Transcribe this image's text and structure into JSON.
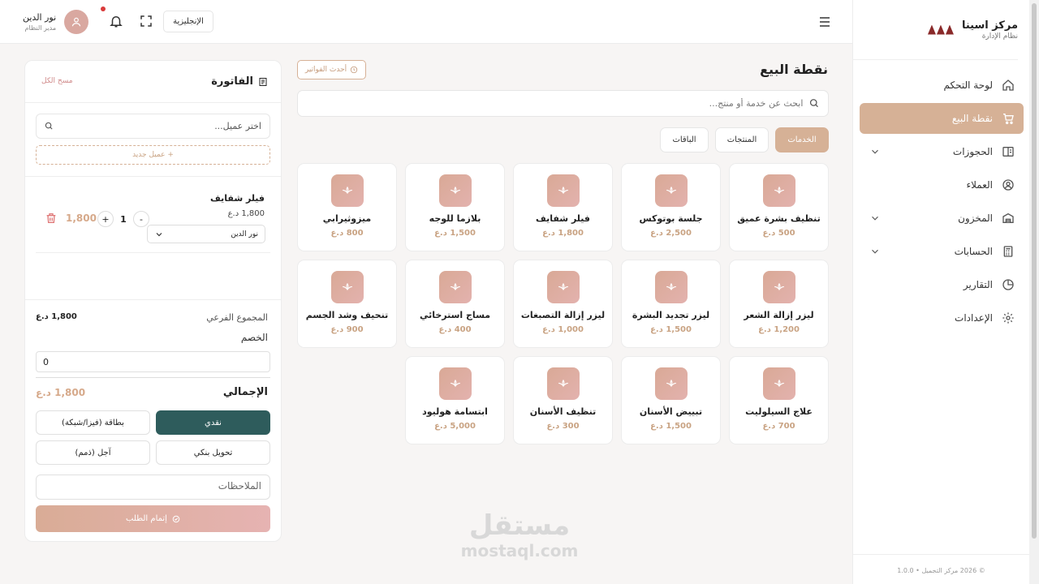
{
  "brand": {
    "logo_text": "AMN",
    "title": "مركز اسينا",
    "subtitle": "نظام الإدارة"
  },
  "sidebar": {
    "items": [
      {
        "label": "لوحة التحكم",
        "icon": "home-icon",
        "active": false,
        "expandable": false
      },
      {
        "label": "نقطة البيع",
        "icon": "cart-icon",
        "active": true,
        "expandable": false
      },
      {
        "label": "الحجوزات",
        "icon": "book-icon",
        "active": false,
        "expandable": true
      },
      {
        "label": "العملاء",
        "icon": "user-circle-icon",
        "active": false,
        "expandable": false
      },
      {
        "label": "المخزون",
        "icon": "warehouse-icon",
        "active": false,
        "expandable": true
      },
      {
        "label": "الحسابات",
        "icon": "calculator-icon",
        "active": false,
        "expandable": true
      },
      {
        "label": "التقارير",
        "icon": "pie-chart-icon",
        "active": false,
        "expandable": false
      },
      {
        "label": "الإعدادات",
        "icon": "gear-icon",
        "active": false,
        "expandable": false
      }
    ],
    "footer": "© 2026 مركز التجميل • 1.0.0"
  },
  "topbar": {
    "user_name": "نور الدين",
    "user_role": "مدير النظام",
    "language": "الإنجليزية"
  },
  "pos": {
    "title": "نقطة البيع",
    "recent_invoices": "أحدث الفواتير",
    "search_placeholder": "ابحث عن خدمة أو منتج...",
    "tabs": [
      {
        "label": "الخدمات",
        "active": true
      },
      {
        "label": "المنتجات",
        "active": false
      },
      {
        "label": "الباقات",
        "active": false
      }
    ],
    "services": [
      {
        "name": "تنظيف بشرة عميق",
        "price": "500 د.ع"
      },
      {
        "name": "جلسة بوتوكس",
        "price": "2,500 د.ع"
      },
      {
        "name": "فيلر شفايف",
        "price": "1,800 د.ع"
      },
      {
        "name": "بلازما للوجه",
        "price": "1,500 د.ع"
      },
      {
        "name": "ميزوثيرابي",
        "price": "800 د.ع"
      },
      {
        "name": "ليزر إزالة الشعر",
        "price": "1,200 د.ع"
      },
      {
        "name": "ليزر تجديد البشرة",
        "price": "1,500 د.ع"
      },
      {
        "name": "ليزر إزالة التصبغات",
        "price": "1,000 د.ع"
      },
      {
        "name": "مساج استرخائي",
        "price": "400 د.ع"
      },
      {
        "name": "تنحيف وشد الجسم",
        "price": "900 د.ع"
      },
      {
        "name": "علاج السيلوليت",
        "price": "700 د.ع"
      },
      {
        "name": "تبييض الأسنان",
        "price": "1,500 د.ع"
      },
      {
        "name": "تنظيف الأسنان",
        "price": "300 د.ع"
      },
      {
        "name": "ابتسامة هوليود",
        "price": "5,000 د.ع"
      }
    ]
  },
  "invoice": {
    "title": "الفاتورة",
    "clear_all": "مسح الكل",
    "customer_placeholder": "اختر عميل...",
    "new_customer": "+ عميل جديد",
    "item": {
      "name": "فيلر شفايف",
      "unit_price": "1,800 د.ع",
      "quantity": "1",
      "line_total": "1,800",
      "staff": "نور الدين"
    },
    "subtotal_label": "المجموع الفرعي",
    "subtotal_value": "1,800 د.ع",
    "discount_label": "الخصم",
    "discount_value": "0",
    "total_label": "الإجمالي",
    "total_value": "1,800 د.ع",
    "payment_methods": [
      {
        "label": "نقدي",
        "active": true
      },
      {
        "label": "بطاقة (فيزا/شبكة)",
        "active": false
      },
      {
        "label": "تحويل بنكي",
        "active": false
      },
      {
        "label": "آجل (ذمم)",
        "active": false
      }
    ],
    "notes_placeholder": "الملاحظات",
    "submit": "إتمام الطلب"
  },
  "watermark": {
    "arabic": "مستقل",
    "latin": "mostaql.com"
  },
  "colors": {
    "accent": "#d6b196",
    "price": "#c9a383",
    "cash_active": "#2e5c5c",
    "icon_gradient_start": "#d9a996",
    "icon_gradient_end": "#e3b2ae"
  }
}
